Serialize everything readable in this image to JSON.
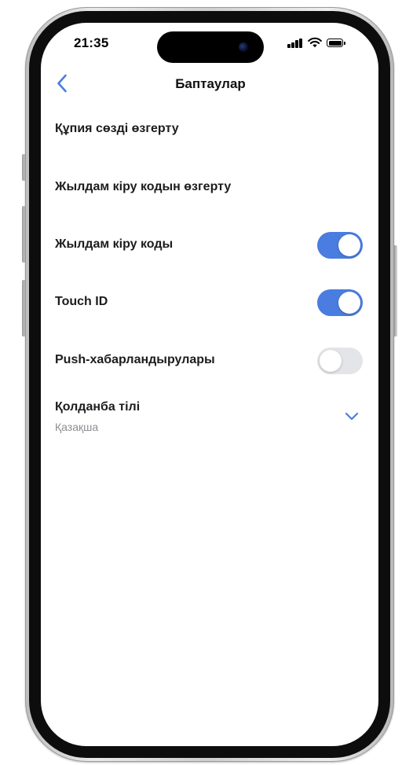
{
  "status_bar": {
    "time": "21:35"
  },
  "header": {
    "title": "Баптаулар",
    "back_icon": "chevron-left-icon"
  },
  "settings": {
    "change_password_label": "Құпия сөзді өзгерту",
    "change_quick_code_label": "Жылдам кіру кодын өзгерту",
    "quick_code": {
      "label": "Жылдам кіру коды",
      "enabled": true
    },
    "touch_id": {
      "label": "Touch ID",
      "enabled": true
    },
    "push": {
      "label": "Push-хабарландырулары",
      "enabled": false
    },
    "language": {
      "label": "Қолданба тілі",
      "selected": "Қазақша",
      "icon": "chevron-down-icon"
    }
  },
  "colors": {
    "accent": "#4a7ddf",
    "toggle_off": "#e4e5e8",
    "secondary_text": "#8e8e93",
    "primary_text": "#1c1c1e"
  }
}
